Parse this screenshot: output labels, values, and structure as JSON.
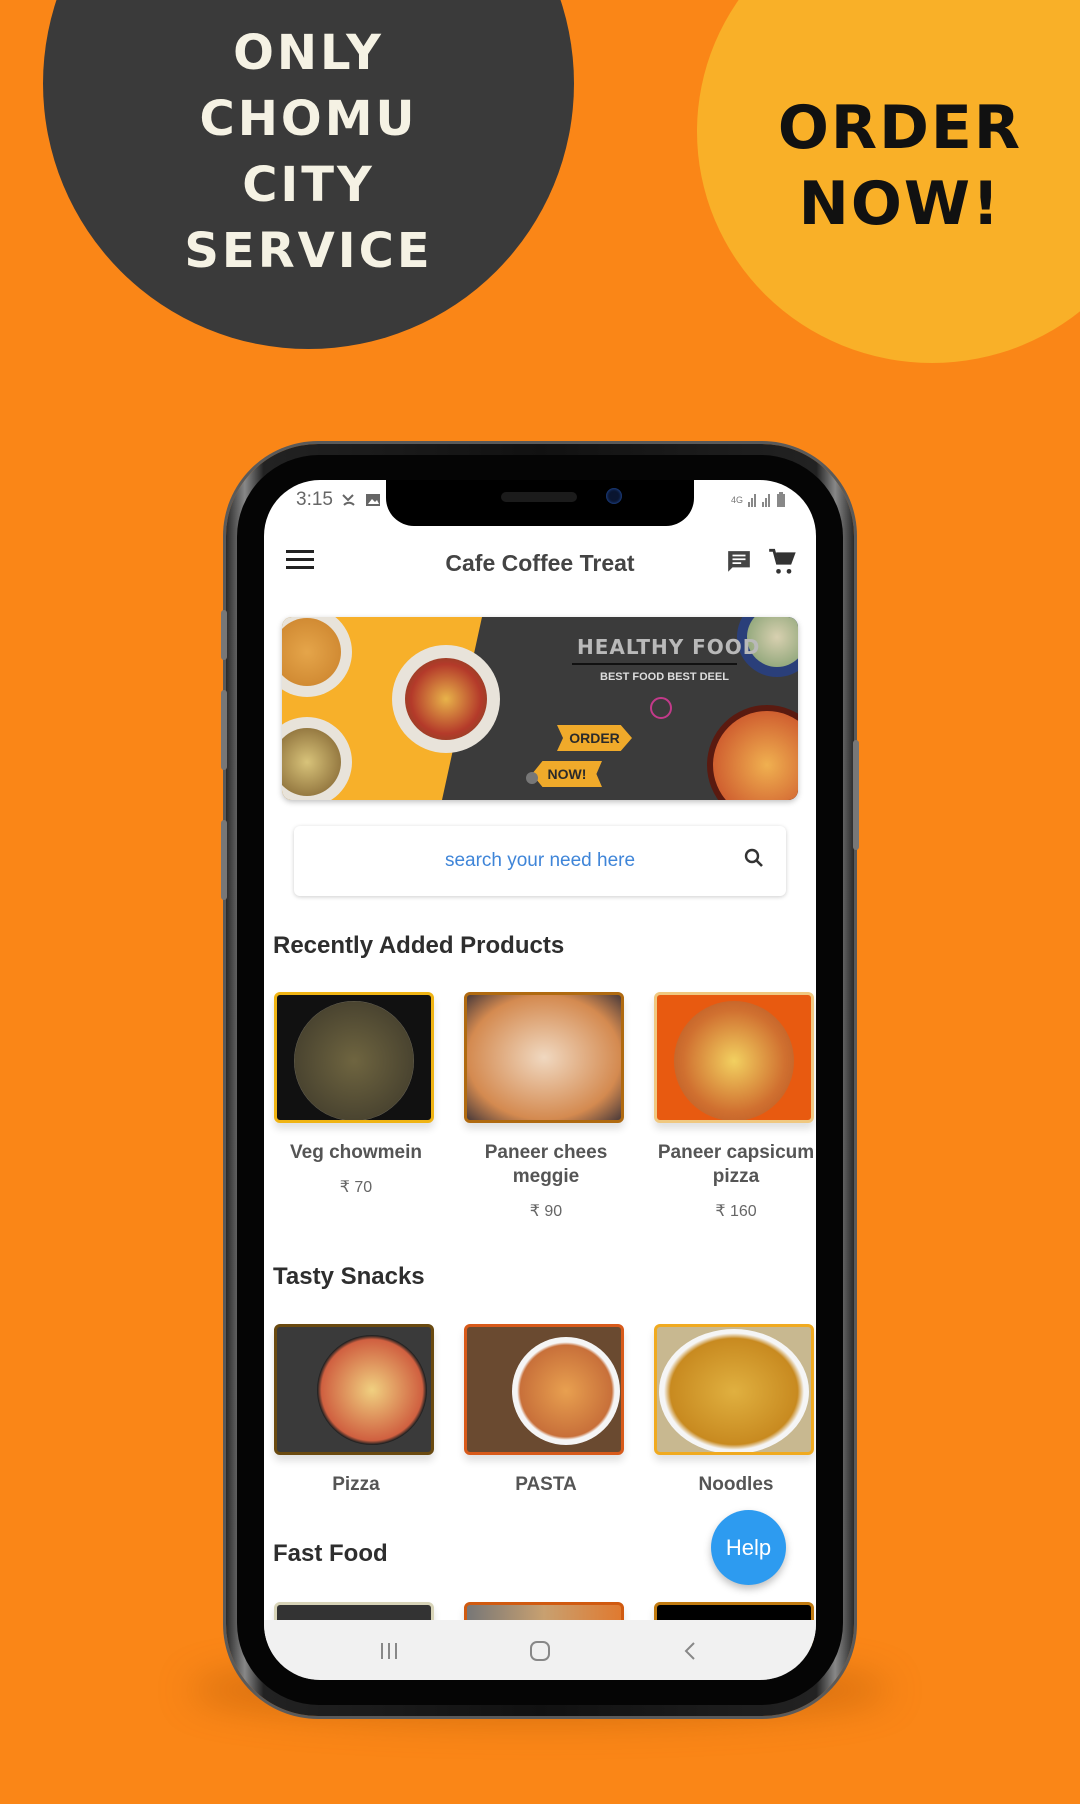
{
  "promo": {
    "left_lines": [
      "ONLY",
      "CHOMU",
      "CITY",
      "SERVICE"
    ],
    "right_lines": [
      "ORDER",
      "NOW!"
    ]
  },
  "status_bar": {
    "time": "3:15",
    "network": "4G"
  },
  "app_bar": {
    "title": "Cafe Coffee Treat",
    "icons": [
      "menu-icon",
      "chat-icon",
      "cart-icon"
    ]
  },
  "banner": {
    "title": "HEALTHY FOOD",
    "subtitle": "BEST FOOD BEST DEEL",
    "sign_top": "ORDER",
    "sign_bottom": "NOW!"
  },
  "search": {
    "placeholder": "search your need here"
  },
  "sections": [
    {
      "title": "Recently Added Products",
      "items": [
        {
          "name": "Veg chowmein",
          "price": "₹ 70"
        },
        {
          "name": "Paneer chees meggie",
          "price": "₹ 90"
        },
        {
          "name": "Paneer capsicum pizza",
          "price": "₹ 160"
        }
      ]
    },
    {
      "title": "Tasty Snacks",
      "items": [
        {
          "name": "Pizza"
        },
        {
          "name": "PASTA"
        },
        {
          "name": "Noodles"
        }
      ]
    },
    {
      "title": "Fast Food",
      "items": []
    }
  ],
  "help_button": {
    "label": "Help"
  },
  "colors": {
    "background": "#fa8617",
    "dark_circle": "#3a3a3a",
    "yellow_circle": "#f9b028",
    "accent_blue": "#2d9bf0",
    "search_text": "#3f85d8"
  }
}
